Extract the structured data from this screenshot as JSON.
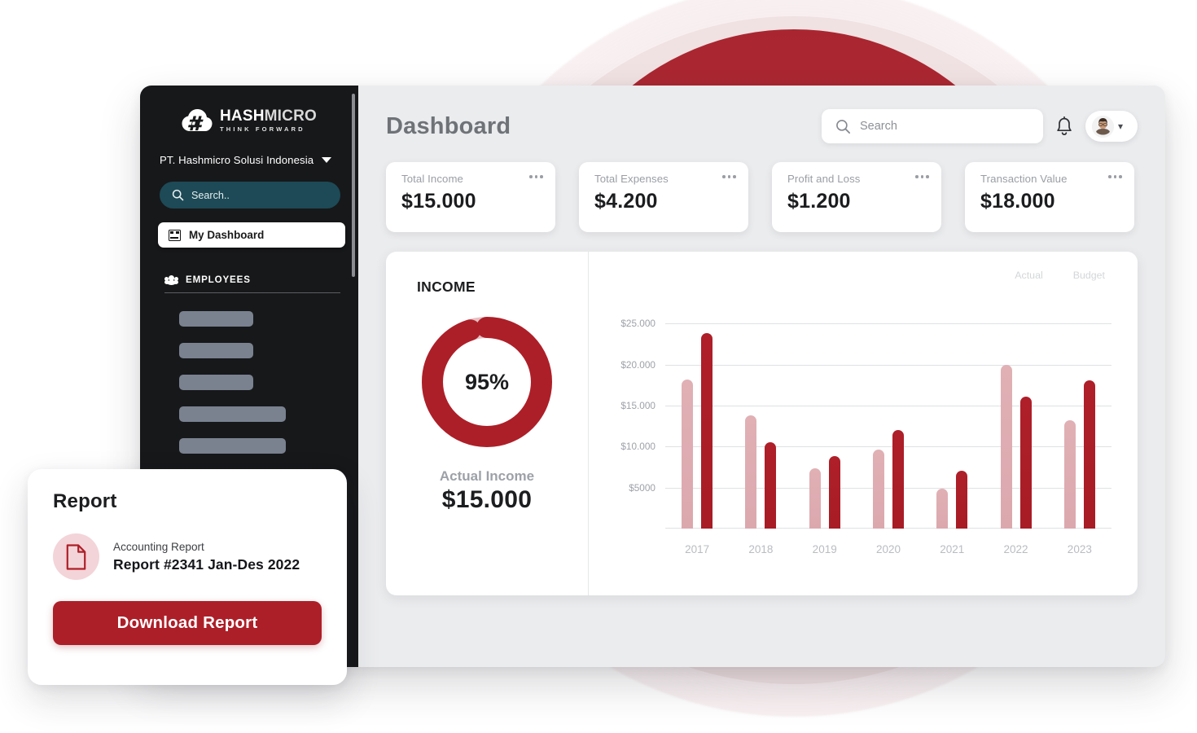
{
  "brand": {
    "logo_primary": "HASH",
    "logo_secondary": "MICRO",
    "logo_tagline": "THINK FORWARD",
    "accent_red": "#ad1f28",
    "accent_pink": "#dba8ae",
    "sidebar_bg": "#17181a",
    "sidebar_search_bg": "#1d4a56"
  },
  "sidebar": {
    "company": "PT. Hashmicro Solusi Indonesia",
    "company_caret_icon": "chevron-down-icon",
    "search_placeholder": "Search..",
    "search_icon": "search-icon",
    "active_item": {
      "label": "My Dashboard",
      "icon": "dashboard-icon"
    },
    "section": {
      "label": "EMPLOYEES",
      "icon": "people-icon"
    },
    "skeleton_widths": [
      "91px",
      "91px",
      "91px",
      "131px",
      "131px"
    ]
  },
  "header": {
    "title": "Dashboard",
    "search_placeholder": "Search",
    "search_value": "",
    "search_icon": "search-icon",
    "bell_icon": "notification-bell-icon",
    "avatar_icon": "user-avatar",
    "avatar_caret_icon": "chevron-down-icon"
  },
  "kpis": [
    {
      "label": "Total Income",
      "value": "$15.000",
      "menu_icon": "more-options-icon"
    },
    {
      "label": "Total Expenses",
      "value": "$4.200",
      "menu_icon": "more-options-icon"
    },
    {
      "label": "Profit and Loss",
      "value": "$1.200",
      "menu_icon": "more-options-icon"
    },
    {
      "label": "Transaction Value",
      "value": "$18.000",
      "menu_icon": "more-options-icon"
    }
  ],
  "income": {
    "title": "INCOME",
    "donut_percent_label": "95%",
    "donut_percent": 95,
    "actual_label": "Actual Income",
    "actual_value": "$15.000"
  },
  "report": {
    "title": "Report",
    "doc_icon": "document-icon",
    "category": "Accounting Report",
    "name": "Report #2341 Jan-Des 2022",
    "button_label": "Download Report"
  },
  "chart_data": {
    "type": "bar",
    "title": "",
    "xlabel": "",
    "ylabel": "",
    "grid": true,
    "legend_position": "top-right",
    "categories": [
      "2017",
      "2018",
      "2019",
      "2020",
      "2021",
      "2022",
      "2023"
    ],
    "ylim": [
      0,
      27000
    ],
    "ytick_values": [
      5000,
      10000,
      15000,
      20000,
      25000
    ],
    "ytick_labels": [
      "$5000",
      "$10.000",
      "$15.000",
      "$20.000",
      "$25.000"
    ],
    "series": [
      {
        "name": "Actual",
        "color": "#dba8ae",
        "values": [
          18200,
          13800,
          7300,
          9600,
          4900,
          20000,
          13200
        ]
      },
      {
        "name": "Budget",
        "color": "#ae1f29",
        "values": [
          23800,
          10500,
          8800,
          12000,
          7000,
          16100,
          18100
        ]
      }
    ]
  }
}
